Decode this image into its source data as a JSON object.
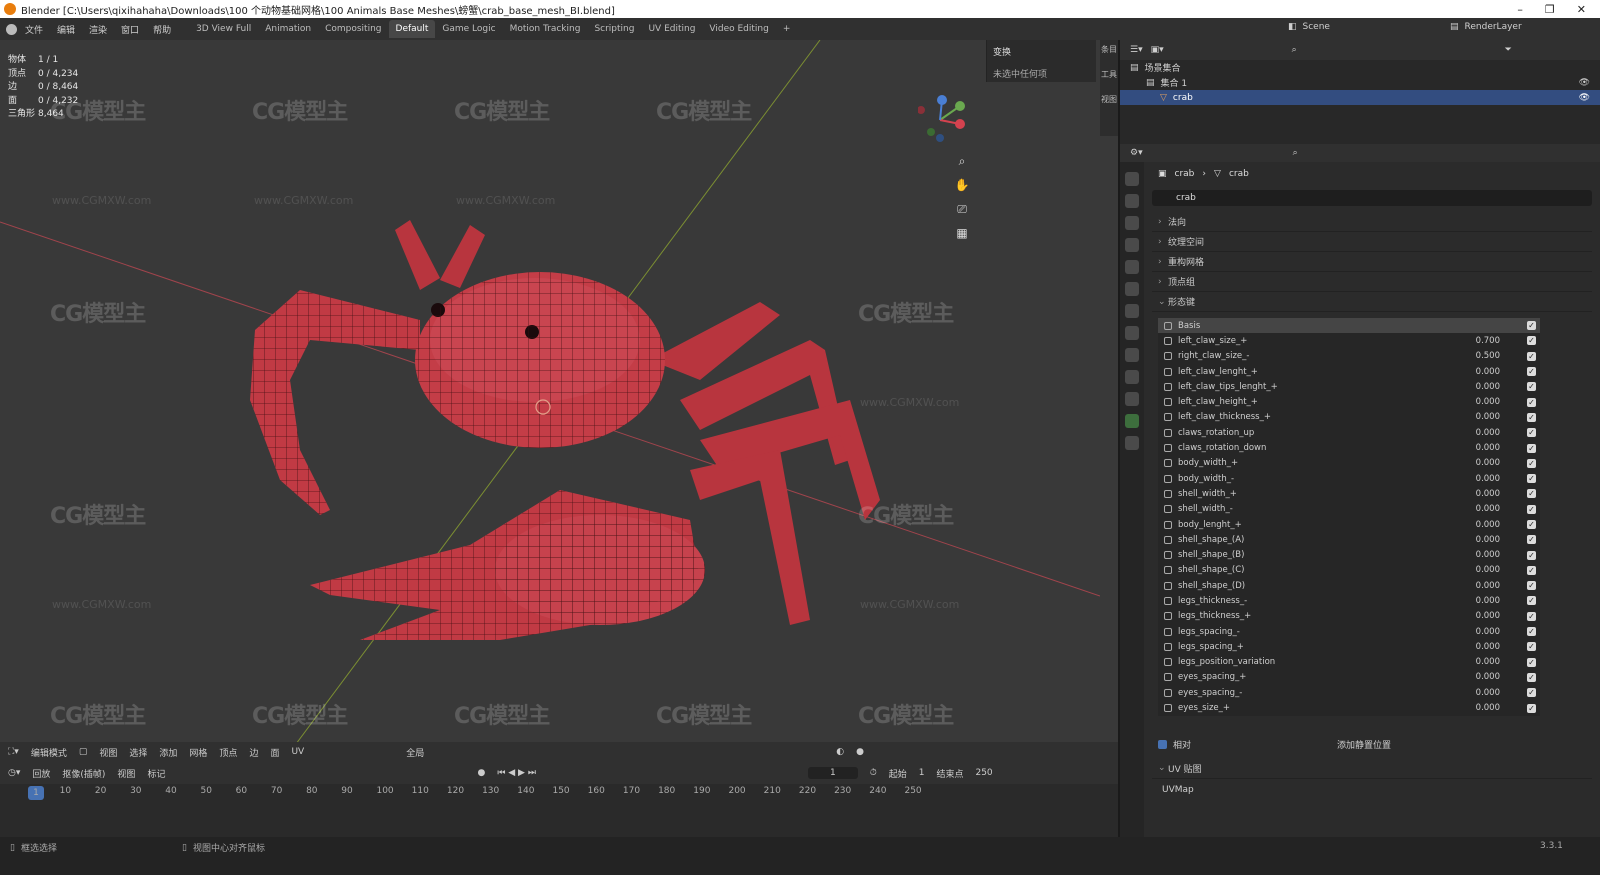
{
  "titlebar": {
    "title": "Blender [C:\\Users\\qixihahaha\\Downloads\\100 个动物基础网格\\100 Animals Base Meshes\\螃蟹\\crab_base_mesh_BI.blend]",
    "minimize": "–",
    "maximize": "❐",
    "close": "✕"
  },
  "menu": [
    "文件",
    "编辑",
    "渲染",
    "窗口",
    "帮助"
  ],
  "workspaces": [
    "3D View Full",
    "Animation",
    "Compositing",
    "Default",
    "Game Logic",
    "Motion Tracking",
    "Scripting",
    "UV Editing",
    "Video Editing",
    "+"
  ],
  "scene": {
    "label": "Scene",
    "render_layer": "RenderLayer"
  },
  "stats": [
    {
      "k": "物体",
      "v": "1 / 1"
    },
    {
      "k": "顶点",
      "v": "0 / 4,234"
    },
    {
      "k": "边",
      "v": "0 / 8,464"
    },
    {
      "k": "面",
      "v": "0 / 4,232"
    },
    {
      "k": "三角形",
      "v": "8,464"
    }
  ],
  "npanel": {
    "header": "变换",
    "empty": "未选中任何项",
    "tabs": [
      "条目",
      "工具",
      "视图"
    ]
  },
  "watermark": {
    "logo": "CG模型主",
    "url": "www.CGMXW.com"
  },
  "viewport_header": {
    "mode": "编辑模式",
    "menus": [
      "视图",
      "选择",
      "添加",
      "网格",
      "顶点",
      "边",
      "面",
      "UV"
    ],
    "orientation": "全局"
  },
  "timeline": {
    "menus": [
      "回放",
      "抠像(插帧)",
      "视图",
      "标记"
    ],
    "frame": "1",
    "start_label": "起始",
    "start": "1",
    "end_label": "结束点",
    "end": "250",
    "ticks": [
      "1",
      "10",
      "20",
      "30",
      "40",
      "50",
      "60",
      "70",
      "80",
      "90",
      "100",
      "110",
      "120",
      "130",
      "140",
      "150",
      "160",
      "170",
      "180",
      "190",
      "200",
      "210",
      "220",
      "230",
      "240",
      "250"
    ]
  },
  "status": {
    "left": "框选选择",
    "middle": "视图中心对齐鼠标",
    "version": "3.3.1"
  },
  "outliner": {
    "root": "场景集合",
    "collection": "集合 1",
    "object": "crab"
  },
  "props": {
    "crumb_obj": "crab",
    "crumb_data": "crab",
    "name": "crab",
    "panels": [
      "法向",
      "纹理空间",
      "重构网格",
      "顶点组",
      "形态键"
    ],
    "relative": "相对",
    "add_rest": "添加静置位置",
    "uv_panel": "UV 贴图",
    "uv_map": "UVMap"
  },
  "shape_keys": [
    {
      "name": "Basis",
      "value": ""
    },
    {
      "name": "left_claw_size_+",
      "value": "0.700"
    },
    {
      "name": "right_claw_size_-",
      "value": "0.500"
    },
    {
      "name": "left_claw_lenght_+",
      "value": "0.000"
    },
    {
      "name": "left_claw_tips_lenght_+",
      "value": "0.000"
    },
    {
      "name": "left_claw_height_+",
      "value": "0.000"
    },
    {
      "name": "left_claw_thickness_+",
      "value": "0.000"
    },
    {
      "name": "claws_rotation_up",
      "value": "0.000"
    },
    {
      "name": "claws_rotation_down",
      "value": "0.000"
    },
    {
      "name": "body_width_+",
      "value": "0.000"
    },
    {
      "name": "body_width_-",
      "value": "0.000"
    },
    {
      "name": "shell_width_+",
      "value": "0.000"
    },
    {
      "name": "shell_width_-",
      "value": "0.000"
    },
    {
      "name": "body_lenght_+",
      "value": "0.000"
    },
    {
      "name": "shell_shape_(A)",
      "value": "0.000"
    },
    {
      "name": "shell_shape_(B)",
      "value": "0.000"
    },
    {
      "name": "shell_shape_(C)",
      "value": "0.000"
    },
    {
      "name": "shell_shape_(D)",
      "value": "0.000"
    },
    {
      "name": "legs_thickness_-",
      "value": "0.000"
    },
    {
      "name": "legs_thickness_+",
      "value": "0.000"
    },
    {
      "name": "legs_spacing_-",
      "value": "0.000"
    },
    {
      "name": "legs_spacing_+",
      "value": "0.000"
    },
    {
      "name": "legs_position_variation",
      "value": "0.000"
    },
    {
      "name": "eyes_spacing_+",
      "value": "0.000"
    },
    {
      "name": "eyes_spacing_-",
      "value": "0.000"
    },
    {
      "name": "eyes_size_+",
      "value": "0.000"
    }
  ]
}
